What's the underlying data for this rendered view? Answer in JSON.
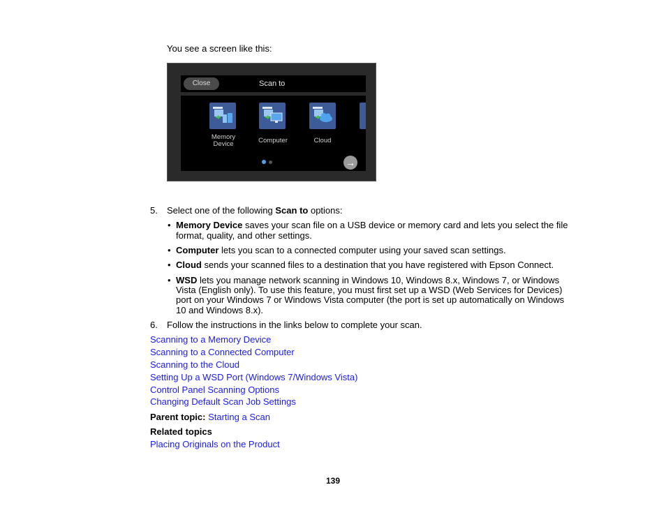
{
  "intro": "You see a screen like this:",
  "screen": {
    "close_label": "Close",
    "title": "Scan to",
    "tiles": [
      {
        "label_line1": "Memory",
        "label_line2": "Device",
        "icon": "memory-device-icon"
      },
      {
        "label_line1": "Computer",
        "label_line2": "",
        "icon": "computer-icon"
      },
      {
        "label_line1": "Cloud",
        "label_line2": "",
        "icon": "cloud-icon"
      }
    ],
    "page_indicator": {
      "current": 1,
      "total": 2
    },
    "next_icon": "→",
    "colors": {
      "tile": "#3d5a99",
      "active_dot": "#4aa3f0",
      "inactive_dot": "#555555"
    }
  },
  "step5": {
    "number": "5.",
    "text_pre": "Select one of the following ",
    "text_bold": "Scan to",
    "text_post": " options:",
    "bullets": [
      {
        "term": "Memory Device",
        "lines": [
          " saves your scan file on a USB device or memory card and lets you select the file",
          "format, quality, and other settings."
        ]
      },
      {
        "term": "Computer",
        "lines": [
          " lets you scan to a connected computer using your saved scan settings."
        ]
      },
      {
        "term": "Cloud",
        "lines": [
          " sends your scanned files to a destination that you have registered with Epson Connect."
        ]
      },
      {
        "term": "WSD",
        "lines": [
          " lets you manage network scanning in Windows 10, Windows 8.x, Windows 7, or Windows",
          "Vista (English only). To use this feature, you must first set up a WSD (Web Services for Devices)",
          "port on your Windows 7 or Windows Vista computer (the port is set up automatically on Windows",
          "10 and Windows 8.x)."
        ]
      }
    ]
  },
  "step6": {
    "number": "6.",
    "text": "Follow the instructions in the links below to complete your scan."
  },
  "links": [
    "Scanning to a Memory Device",
    "Scanning to a Connected Computer",
    "Scanning to the Cloud",
    "Setting Up a WSD Port (Windows 7/Windows Vista)",
    "Control Panel Scanning Options",
    "Changing Default Scan Job Settings"
  ],
  "parent_topic": {
    "label": "Parent topic:",
    "link": "Starting a Scan"
  },
  "related_topics": {
    "heading": "Related topics",
    "links": [
      "Placing Originals on the Product"
    ]
  },
  "page_number": "139",
  "colors": {
    "link": "#1a1aff"
  }
}
